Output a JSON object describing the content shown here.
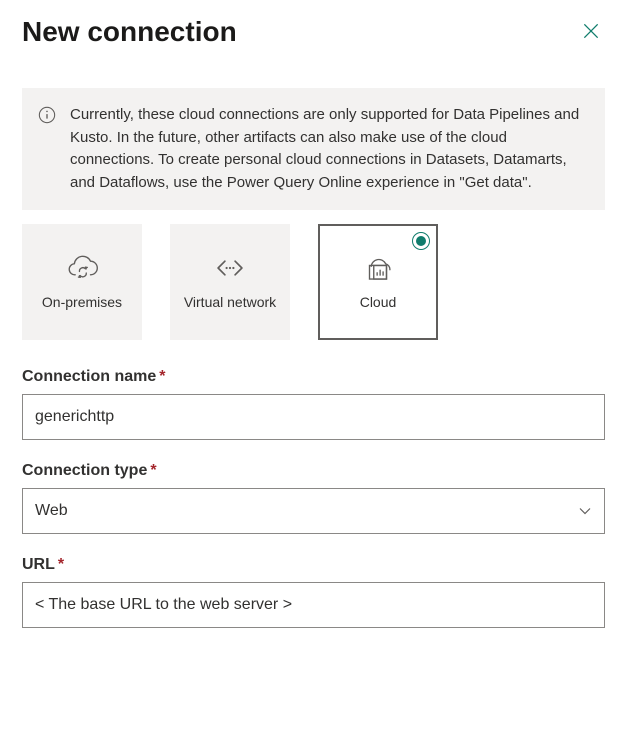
{
  "dialog": {
    "title": "New connection"
  },
  "info": {
    "message": "Currently, these cloud connections are only supported for Data Pipelines and Kusto. In the future, other artifacts can also make use of the cloud connections. To create personal cloud connections in Datasets, Datamarts, and Dataflows, use the Power Query Online experience in \"Get data\"."
  },
  "tiles": {
    "onprem": "On-premises",
    "virtual": "Virtual network",
    "cloud": "Cloud",
    "selected": "cloud"
  },
  "fields": {
    "connection_name": {
      "label": "Connection name",
      "value": "generichttp"
    },
    "connection_type": {
      "label": "Connection type",
      "value": "Web"
    },
    "url": {
      "label": "URL",
      "value": "< The base URL to the web server >"
    }
  }
}
